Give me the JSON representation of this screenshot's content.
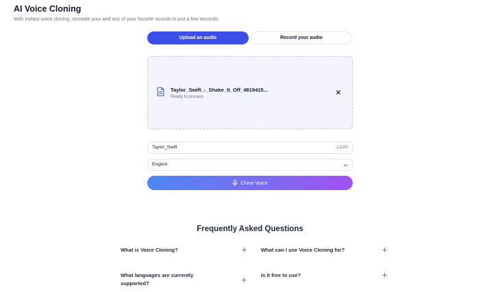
{
  "header": {
    "title": "AI Voice Cloning",
    "subtitle": "With instant voice cloning, recreate your and any of your favorite sounds in just a few seconds."
  },
  "tabs": [
    {
      "label": "Upload an audio",
      "active": true
    },
    {
      "label": "Record your audio",
      "active": false
    }
  ],
  "upload": {
    "file_name": "Taylor_Swift_-_Shake_It_Off_4819415...",
    "status": "Ready to process",
    "file_icon": "document-icon",
    "remove_icon": "close-icon"
  },
  "form": {
    "name_value": "Taylor_Swift",
    "name_counter": "12/20",
    "language_selected": "English",
    "clone_button_label": "Clone Voice",
    "clone_button_icon": "microphone-icon"
  },
  "faq": {
    "title": "Frequently Asked Questions",
    "items": [
      {
        "question": "What is Voice Cloning?"
      },
      {
        "question": "What can I use Voice Cloning for?"
      },
      {
        "question": "What languages are currently supported?"
      },
      {
        "question": "Is it free to use?"
      }
    ]
  },
  "colors": {
    "primary": "#3b4ee6",
    "dropzone_bg": "#f4f4fd",
    "gradient_start": "#4f86f4",
    "gradient_end": "#a152f2"
  }
}
